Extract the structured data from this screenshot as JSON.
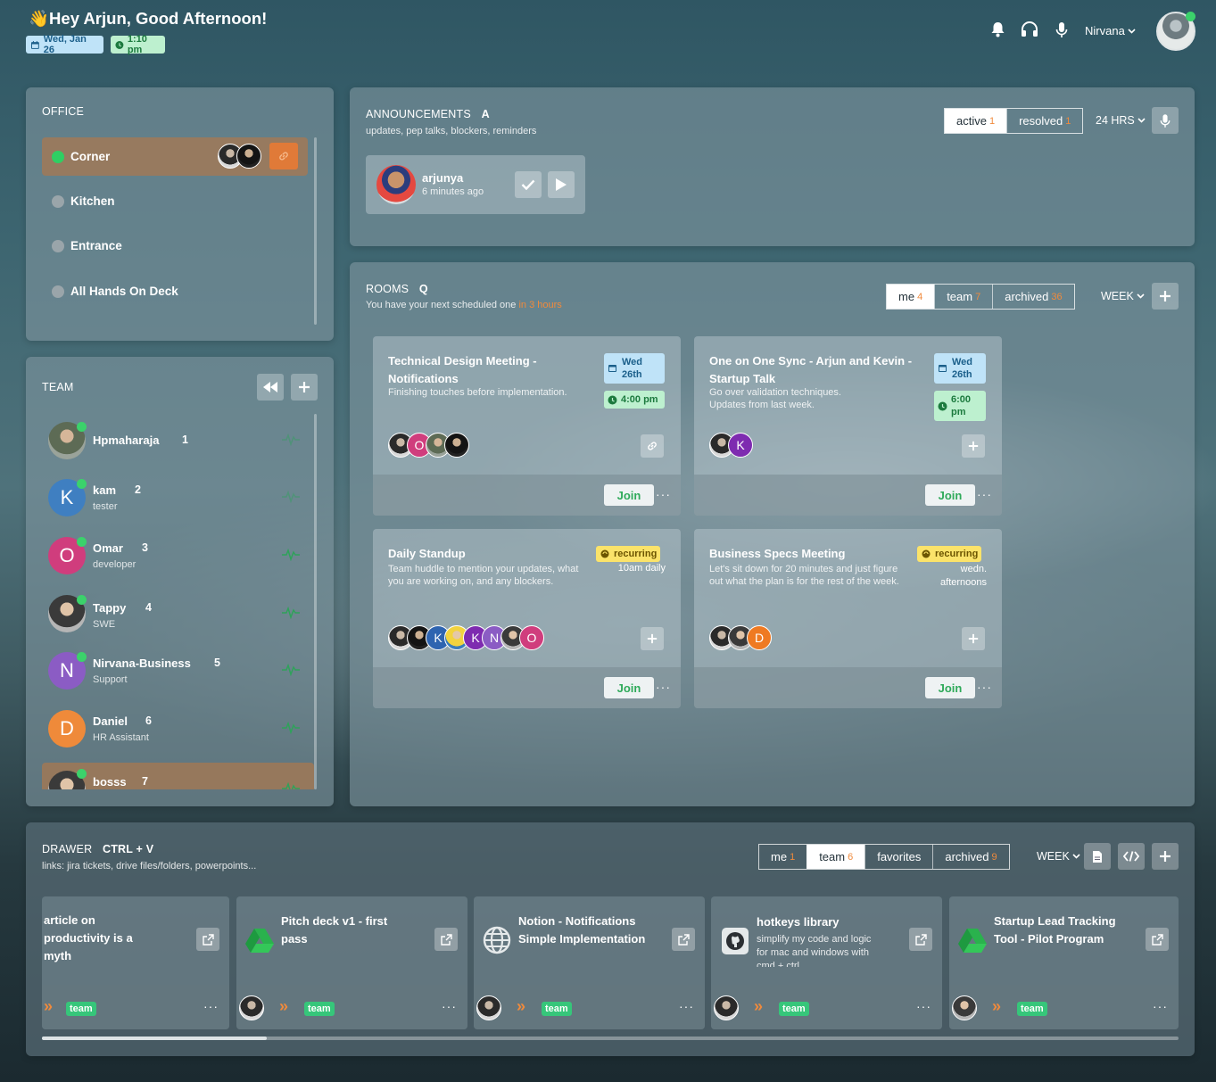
{
  "header": {
    "greeting": "Hey Arjun, Good Afternoon!",
    "date": "Wed, Jan 26",
    "time": "1:10 pm",
    "workspace": "Nirvana"
  },
  "office": {
    "title": "OFFICE",
    "rooms": [
      {
        "label": "Corner",
        "status": "active"
      },
      {
        "label": "Kitchen",
        "status": "idle"
      },
      {
        "label": "Entrance",
        "status": "idle"
      },
      {
        "label": "All Hands On Deck",
        "status": "idle"
      }
    ]
  },
  "team": {
    "title": "TEAM",
    "members": [
      {
        "name": "Hpmaharaja",
        "num": "1",
        "role": "",
        "initial": "",
        "color": ""
      },
      {
        "name": "kam",
        "num": "2",
        "role": "tester",
        "initial": "K",
        "color": "#3f7fc1"
      },
      {
        "name": "Omar",
        "num": "3",
        "role": "developer",
        "initial": "O",
        "color": "#d03d7d"
      },
      {
        "name": "Tappy",
        "num": "4",
        "role": "SWE",
        "initial": "",
        "color": ""
      },
      {
        "name": "Nirvana-Business",
        "num": "5",
        "role": "Support",
        "initial": "N",
        "color": "#8b5cc4"
      },
      {
        "name": "Daniel",
        "num": "6",
        "role": "HR Assistant",
        "initial": "D",
        "color": "#ef8a3a"
      },
      {
        "name": "bosss",
        "num": "7",
        "role": "",
        "initial": "",
        "color": ""
      }
    ]
  },
  "announcements": {
    "title": "ANNOUNCEMENTS",
    "hotkey": "A",
    "subtitle": "updates, pep talks, blockers, reminders",
    "tabs": [
      {
        "label": "active",
        "count": "1"
      },
      {
        "label": "resolved",
        "count": "1"
      }
    ],
    "range": "24 HRS",
    "item": {
      "user": "arjunya",
      "time": "6 minutes ago"
    }
  },
  "rooms": {
    "title": "ROOMS",
    "hotkey": "Q",
    "subtitle_prefix": "You have your next scheduled one",
    "subtitle_highlight": "in 3 hours",
    "tabs": [
      {
        "label": "me",
        "count": "4"
      },
      {
        "label": "team",
        "count": "7"
      },
      {
        "label": "archived",
        "count": "36"
      }
    ],
    "range": "WEEK",
    "cards": [
      {
        "title": "Technical Design Meeting - Notifications",
        "desc": "Finishing touches before implementation.",
        "date": "Wed 26th",
        "time": "4:00 pm",
        "join": "Join"
      },
      {
        "title": "One on One Sync - Arjun and Kevin - Startup Talk",
        "desc": "Go over validation techniques. Updates from last week.",
        "date": "Wed 26th",
        "time": "6:00 pm",
        "join": "Join"
      },
      {
        "title": "Daily Standup",
        "desc": "Team huddle to mention your updates, what you are working on, and any blockers.",
        "badge": "recurring",
        "schedule": "10am daily",
        "join": "Join"
      },
      {
        "title": "Business Specs Meeting",
        "desc": "Let's sit down for 20 minutes and just figure out what the plan is for the rest of the week.",
        "badge": "recurring",
        "schedule": "wedn. afternoons",
        "join": "Join"
      }
    ]
  },
  "drawer": {
    "title": "DRAWER",
    "hotkey": "CTRL + V",
    "subtitle": "links: jira tickets, drive files/folders, powerpoints...",
    "tabs": [
      {
        "label": "me",
        "count": "1"
      },
      {
        "label": "team",
        "count": "6"
      },
      {
        "label": "favorites",
        "count": ""
      },
      {
        "label": "archived",
        "count": "9"
      }
    ],
    "range": "WEEK",
    "items": [
      {
        "title": "article on productivity is a myth",
        "icon": "none",
        "tag": "team"
      },
      {
        "title": "Pitch deck v1 - first pass",
        "icon": "google-drive-icon",
        "tag": "team"
      },
      {
        "title": "Notion - Notifications Simple Implementation",
        "icon": "globe-icon",
        "tag": "team"
      },
      {
        "title": "hotkeys library",
        "desc": "simplify my code and logic for mac and windows with cmd + ctrl",
        "icon": "github-icon",
        "tag": "team"
      },
      {
        "title": "Startup Lead Tracking Tool - Pilot Program",
        "icon": "google-drive-icon",
        "tag": "team"
      }
    ]
  },
  "colors": {
    "accent_green": "#36c67a",
    "accent_orange": "#f08a3c",
    "date_blue": "#bfe3f8"
  }
}
